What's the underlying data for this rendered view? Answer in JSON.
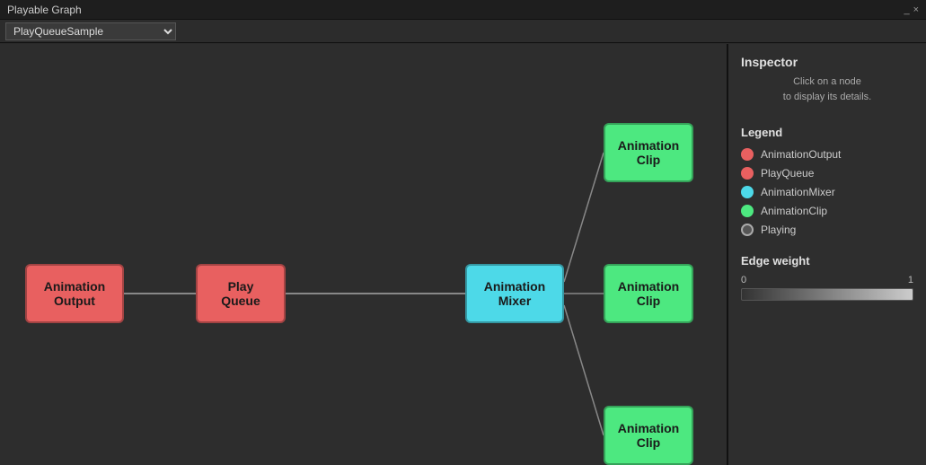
{
  "titleBar": {
    "title": "Playable Graph",
    "minimize": "_",
    "close": "×"
  },
  "dropdown": {
    "value": "PlayQueueSample",
    "options": [
      "PlayQueueSample"
    ]
  },
  "nodes": {
    "animationOutput": {
      "label": "Animation\nOutput"
    },
    "playQueue": {
      "label": "Play\nQueue"
    },
    "animationMixer": {
      "label": "Animation\nMixer"
    },
    "clipTop": {
      "label": "Animation\nClip"
    },
    "clipMid": {
      "label": "Animation\nClip"
    },
    "clipBot": {
      "label": "Animation\nClip"
    }
  },
  "inspector": {
    "title": "Inspector",
    "subtitle": "Click on a node\nto display its details."
  },
  "legend": {
    "title": "Legend",
    "items": [
      {
        "key": "output",
        "label": "AnimationOutput",
        "color": "#e86060"
      },
      {
        "key": "playqueue",
        "label": "PlayQueue",
        "color": "#e86060"
      },
      {
        "key": "mixer",
        "label": "AnimationMixer",
        "color": "#4dd9e8"
      },
      {
        "key": "clip",
        "label": "AnimationClip",
        "color": "#4de880"
      },
      {
        "key": "playing",
        "label": "Playing",
        "color": "#888"
      }
    ]
  },
  "edgeWeight": {
    "title": "Edge weight",
    "min": "0",
    "max": "1"
  }
}
